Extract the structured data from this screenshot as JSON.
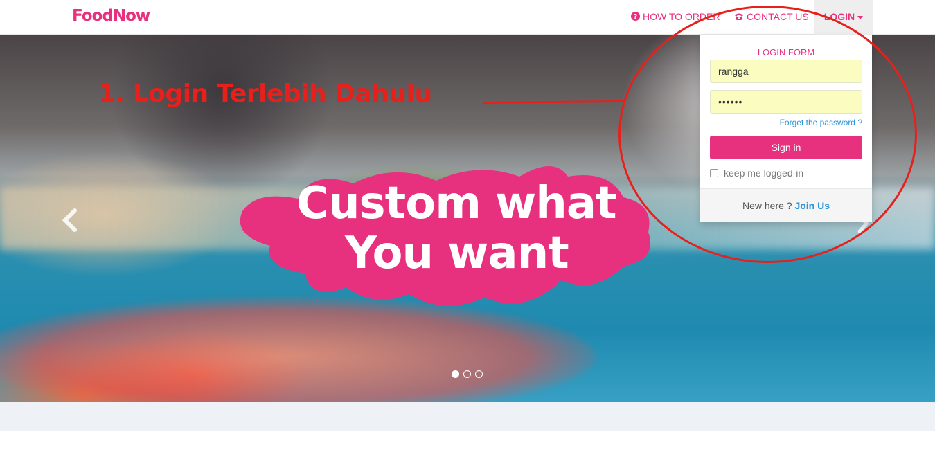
{
  "navbar": {
    "brand": "FoodNow",
    "links": [
      {
        "label": "HOW TO ORDER",
        "icon": "question-circle-icon"
      },
      {
        "label": "CONTACT US",
        "icon": "phone-icon"
      }
    ],
    "login_label": "LOGIN"
  },
  "hero": {
    "headline_line1": "Custom what",
    "headline_line2": "You want",
    "annotation": "1. Login Terlebih Dahulu",
    "slides_count": 3,
    "active_slide": 1
  },
  "login_form": {
    "title": "LOGIN FORM",
    "username_value": "rangga",
    "password_value": "••••••",
    "forgot_label": "Forget the password ?",
    "signin_label": "Sign in",
    "keep_label": "keep me logged-in",
    "footer_text": "New here ?",
    "join_label": "Join Us"
  },
  "colors": {
    "brand": "#e8317e",
    "link": "#2a93d5",
    "annotation": "#e8201c",
    "autofill": "#fafcc0"
  }
}
